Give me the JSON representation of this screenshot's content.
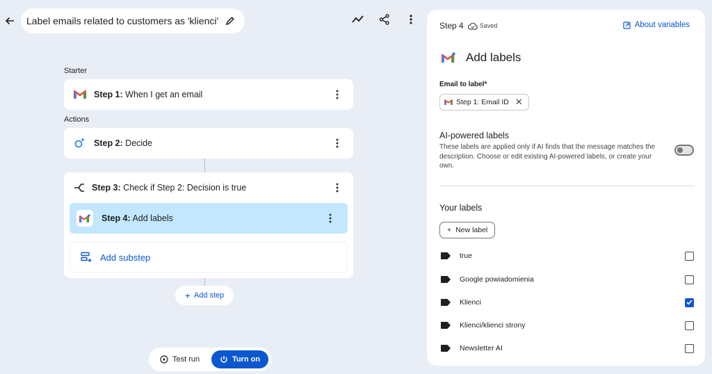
{
  "header": {
    "title": "Label emails related to customers as 'klienci'"
  },
  "flow": {
    "starter_label": "Starter",
    "actions_label": "Actions",
    "steps": [
      {
        "prefix": "Step 1:",
        "text": " When I get an email"
      },
      {
        "prefix": "Step 2:",
        "text": " Decide"
      },
      {
        "prefix": "Step 3:",
        "text": " Check if Step 2: Decision is true"
      },
      {
        "prefix": "Step 4:",
        "text": " Add labels"
      }
    ],
    "add_substep": "Add substep",
    "add_step": "Add step",
    "test_run": "Test run",
    "turn_on": "Turn on"
  },
  "panel": {
    "step": "Step 4",
    "saved": "Saved",
    "about_variables": "About variables",
    "title": "Add labels",
    "email_field_label": "Email to label*",
    "email_chip": "Step 1: Email ID",
    "ai_title": "AI-powered labels",
    "ai_desc": "These labels are applied only if AI finds that the message matches the description. Choose or edit existing AI-powered labels, or create your own.",
    "ai_enabled": false,
    "your_labels": "Your labels",
    "new_label": "New label",
    "labels": [
      {
        "name": "true",
        "checked": false
      },
      {
        "name": "Google powiadomienia",
        "checked": false
      },
      {
        "name": "Klienci",
        "checked": true
      },
      {
        "name": "Klienci/klienci strony",
        "checked": false
      },
      {
        "name": "Newsletter AI",
        "checked": false
      }
    ]
  },
  "colors": {
    "accent": "#0b57d0",
    "selected_step": "#c2e7ff",
    "background": "#e9eef6"
  }
}
